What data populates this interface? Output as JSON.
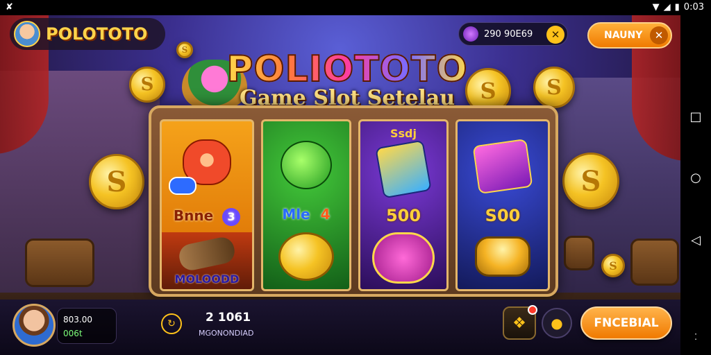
{
  "status_bar": {
    "left_icon": "status-app-icon",
    "time": "0:03"
  },
  "header": {
    "logo": "POLOTOTO",
    "balance": "290 90E69",
    "top_button": "NAUNY"
  },
  "title": {
    "main": "POLIOTOTO",
    "sub": "Game Slot Setelau"
  },
  "reels": [
    {
      "top_label": "",
      "mid_label": "Bnne",
      "mid_num": "3",
      "bottom_label": "MOLOODD"
    },
    {
      "top_label": "",
      "mid_label": "Mle",
      "mid_num": "4",
      "bottom_label": ""
    },
    {
      "top_label": "Ssdj",
      "mid_label": "500",
      "mid_num": "",
      "bottom_label": ""
    },
    {
      "top_label": "",
      "mid_label": "S00",
      "mid_num": "",
      "bottom_label": ""
    }
  ],
  "bottom": {
    "stat1": "803.00",
    "stat2": "006t",
    "center_value": "2 1061",
    "center_sub": "MGONONDIAD",
    "play_button": "FNCEBIAL"
  },
  "colors": {
    "accent": "#f07a00",
    "gold": "#ffc21a"
  }
}
